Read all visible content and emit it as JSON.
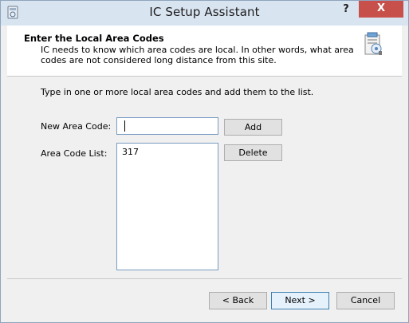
{
  "window": {
    "title": "IC Setup Assistant",
    "help_label": "?",
    "close_label": "X"
  },
  "header": {
    "title": "Enter the Local Area Codes",
    "subtitle": "IC needs to know which area codes are local. In other words, what area codes are not considered long distance from this site."
  },
  "main": {
    "instruction": "Type in one or more local area codes and add them to the list.",
    "new_area_code_label": "New Area Code:",
    "new_area_code_value": "",
    "area_code_list_label": "Area Code List:",
    "area_codes": [
      "317"
    ],
    "add_label": "Add",
    "delete_label": "Delete"
  },
  "footer": {
    "back_label": "< Back",
    "next_label": "Next >",
    "cancel_label": "Cancel"
  },
  "colors": {
    "close_button": "#c7504b",
    "titlebar": "#d9e4f1",
    "field_border": "#7a9cc2",
    "default_button_border": "#3c7fb1"
  }
}
